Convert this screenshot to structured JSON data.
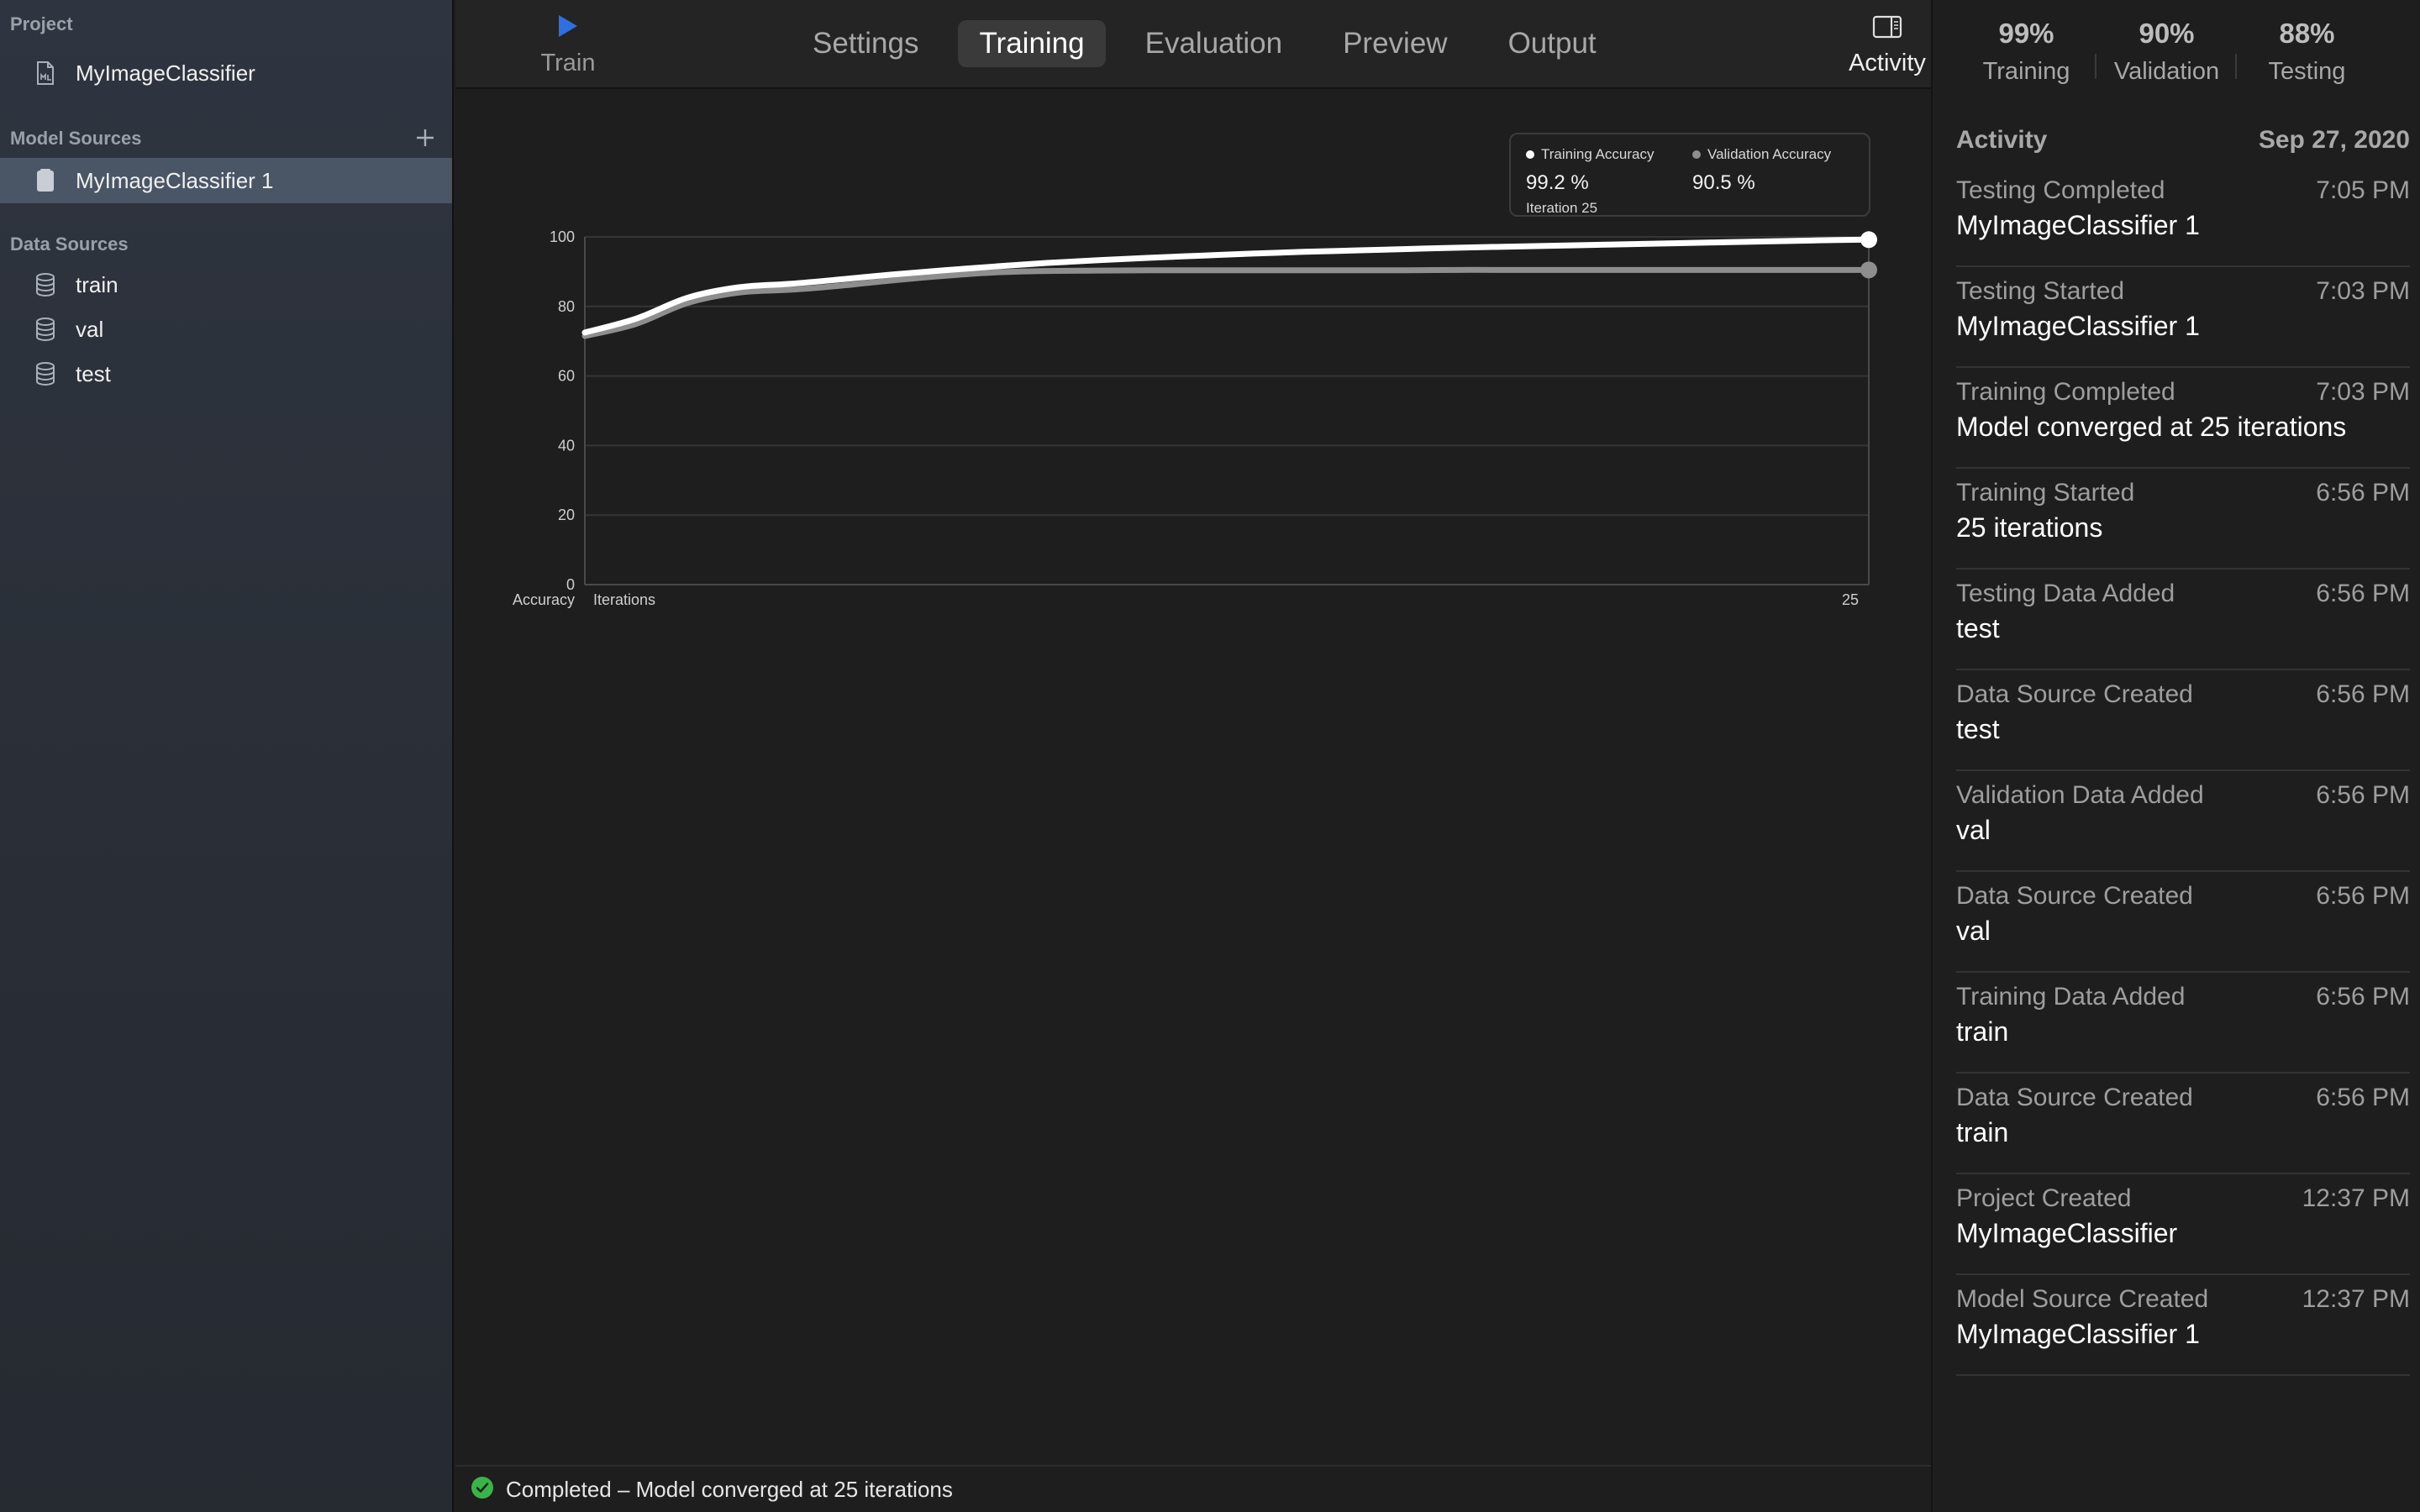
{
  "sidebar": {
    "project_header": "Project",
    "project_item": "MyImageClassifier",
    "model_sources_header": "Model Sources",
    "model_sources": [
      {
        "label": "MyImageClassifier 1"
      }
    ],
    "data_sources_header": "Data Sources",
    "data_sources": [
      {
        "label": "train"
      },
      {
        "label": "val"
      },
      {
        "label": "test"
      }
    ]
  },
  "toolbar": {
    "train_label": "Train",
    "tabs": [
      {
        "label": "Settings"
      },
      {
        "label": "Training"
      },
      {
        "label": "Evaluation"
      },
      {
        "label": "Preview"
      },
      {
        "label": "Output"
      }
    ],
    "active_tab": "Training",
    "activity_label": "Activity"
  },
  "tooltip": {
    "training_name": "Training Accuracy",
    "training_value": "99.2 %",
    "validation_name": "Validation Accuracy",
    "validation_value": "90.5 %",
    "iteration": "Iteration 25"
  },
  "chart_data": {
    "type": "line",
    "ylabel": "Accuracy",
    "xlabel": "Iterations",
    "xlim": [
      0,
      25
    ],
    "ylim": [
      0,
      100
    ],
    "y_ticks": [
      0,
      20,
      40,
      60,
      80,
      100
    ],
    "x_tick_labels": [
      "25"
    ],
    "grid": true,
    "legend": "top-right",
    "x": [
      0,
      1,
      2,
      3,
      4,
      5,
      6,
      7,
      8,
      9,
      10,
      11,
      12,
      13,
      14,
      15,
      16,
      17,
      18,
      19,
      20,
      21,
      22,
      23,
      24,
      25
    ],
    "series": [
      {
        "name": "Training Accuracy",
        "color": "#ffffff",
        "values": [
          72.5,
          76.5,
          82.5,
          85.5,
          86.5,
          87.8,
          89.2,
          90.4,
          91.5,
          92.5,
          93.3,
          94.0,
          94.6,
          95.2,
          95.7,
          96.1,
          96.5,
          96.9,
          97.2,
          97.5,
          97.8,
          98.1,
          98.4,
          98.7,
          99.0,
          99.2
        ]
      },
      {
        "name": "Validation Accuracy",
        "color": "#8e8e8e",
        "values": [
          71.5,
          75.0,
          81.0,
          84.0,
          84.8,
          86.0,
          87.5,
          88.8,
          89.8,
          90.2,
          90.3,
          90.4,
          90.4,
          90.4,
          90.4,
          90.4,
          90.4,
          90.5,
          90.5,
          90.5,
          90.5,
          90.5,
          90.5,
          90.5,
          90.5,
          90.5
        ]
      }
    ]
  },
  "status": {
    "text": "Completed – Model converged at 25 iterations",
    "color": "#3cb34a"
  },
  "metrics": [
    {
      "pct": "99%",
      "name": "Training"
    },
    {
      "pct": "90%",
      "name": "Validation"
    },
    {
      "pct": "88%",
      "name": "Testing"
    }
  ],
  "activity": {
    "header": "Activity",
    "date": "Sep 27, 2020",
    "items": [
      {
        "title": "Testing Completed",
        "time": "7:05 PM",
        "subtitle": "MyImageClassifier 1"
      },
      {
        "title": "Testing Started",
        "time": "7:03 PM",
        "subtitle": "MyImageClassifier 1"
      },
      {
        "title": "Training Completed",
        "time": "7:03 PM",
        "subtitle": "Model converged at 25 iterations"
      },
      {
        "title": "Training Started",
        "time": "6:56 PM",
        "subtitle": "25 iterations"
      },
      {
        "title": "Testing Data Added",
        "time": "6:56 PM",
        "subtitle": "test"
      },
      {
        "title": "Data Source Created",
        "time": "6:56 PM",
        "subtitle": "test"
      },
      {
        "title": "Validation Data Added",
        "time": "6:56 PM",
        "subtitle": "val"
      },
      {
        "title": "Data Source Created",
        "time": "6:56 PM",
        "subtitle": "val"
      },
      {
        "title": "Training Data Added",
        "time": "6:56 PM",
        "subtitle": "train"
      },
      {
        "title": "Data Source Created",
        "time": "6:56 PM",
        "subtitle": "train"
      },
      {
        "title": "Project Created",
        "time": "12:37 PM",
        "subtitle": "MyImageClassifier"
      },
      {
        "title": "Model Source Created",
        "time": "12:37 PM",
        "subtitle": "MyImageClassifier 1"
      }
    ]
  },
  "colors": {
    "accent_blue": "#2f6fe0",
    "sidebar_selected": "#4a5566"
  },
  "icons": {
    "train": "play-icon",
    "activity": "sidebar-toggle-icon",
    "project": "ml-document-icon",
    "model_source": "model-source-icon",
    "data_source": "database-icon",
    "add": "plus-icon",
    "status": "checkmark-circle-icon"
  }
}
